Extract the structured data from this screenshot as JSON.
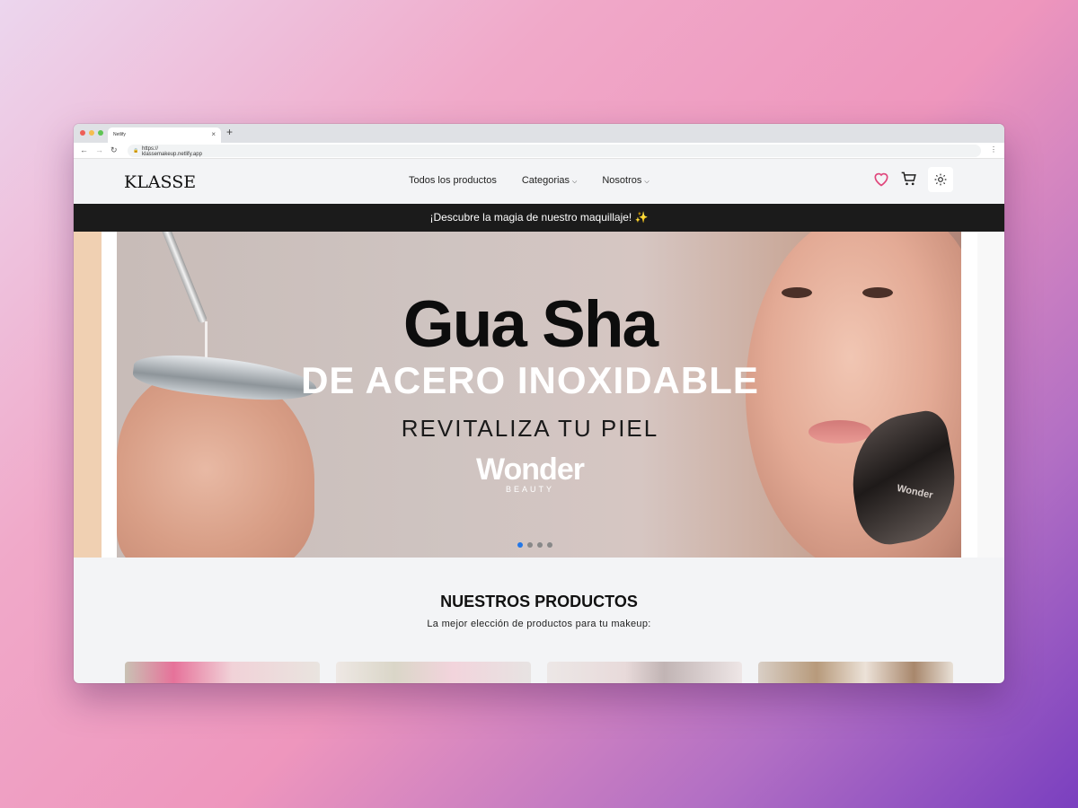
{
  "browser": {
    "tab_title": "Netlify",
    "tab_close": "×",
    "new_tab": "+",
    "url": "https://\nklassemakeup.netlify.app"
  },
  "header": {
    "logo": "KLASSE",
    "nav": [
      {
        "label": "Todos los productos"
      },
      {
        "label": "Categorias"
      },
      {
        "label": "Nosotros"
      }
    ]
  },
  "announcement": "¡Descubre la magia de nuestro maquillaje! ✨",
  "hero": {
    "title": "Gua Sha",
    "subtitle": "DE ACERO INOXIDABLE",
    "tagline": "REVITALIZA TU PIEL",
    "brand": "Wonder",
    "brand_sub": "BEAUTY",
    "stone_label": "Wonder",
    "slides_total": 4,
    "active_slide": 1
  },
  "products": {
    "title": "NUESTROS PRODUCTOS",
    "subtitle": "La mejor elección de productos para tu makeup:"
  },
  "colors": {
    "accent": "#2377e7",
    "heart": "#e0457b",
    "announce_bg": "#1b1b1b"
  }
}
